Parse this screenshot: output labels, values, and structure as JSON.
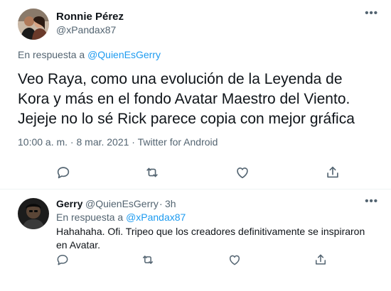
{
  "main_tweet": {
    "author_name": "Ronnie Pérez",
    "author_handle": "@xPandax87",
    "reply_prefix": "En respuesta a ",
    "reply_to": "@QuienEsGerry",
    "text": "Veo Raya, como una evolución de la Leyenda de Kora y más en el fondo Avatar Maestro del Viento. Jejeje no lo sé Rick parece copia con mejor gráfica",
    "timestamp": "10:00 a. m. · 8 mar. 2021 · Twitter for Android",
    "more_label": "•••"
  },
  "reply_tweet": {
    "author_name": "Gerry",
    "author_handle": "@QuienEsGerry",
    "separator": "·",
    "time": "3h",
    "reply_prefix": "En respuesta a ",
    "reply_to": "@xPandax87",
    "text": "Hahahaha. Ofi. Tripeo que los creadores definitivamente se inspiraron en Avatar.",
    "more_label": "•••"
  },
  "icons": [
    "reply-icon",
    "retweet-icon",
    "like-icon",
    "share-icon"
  ],
  "colors": {
    "link": "#1d9bf0",
    "secondary_text": "#536471",
    "primary_text": "#0f1419",
    "divider": "#eff3f4"
  }
}
